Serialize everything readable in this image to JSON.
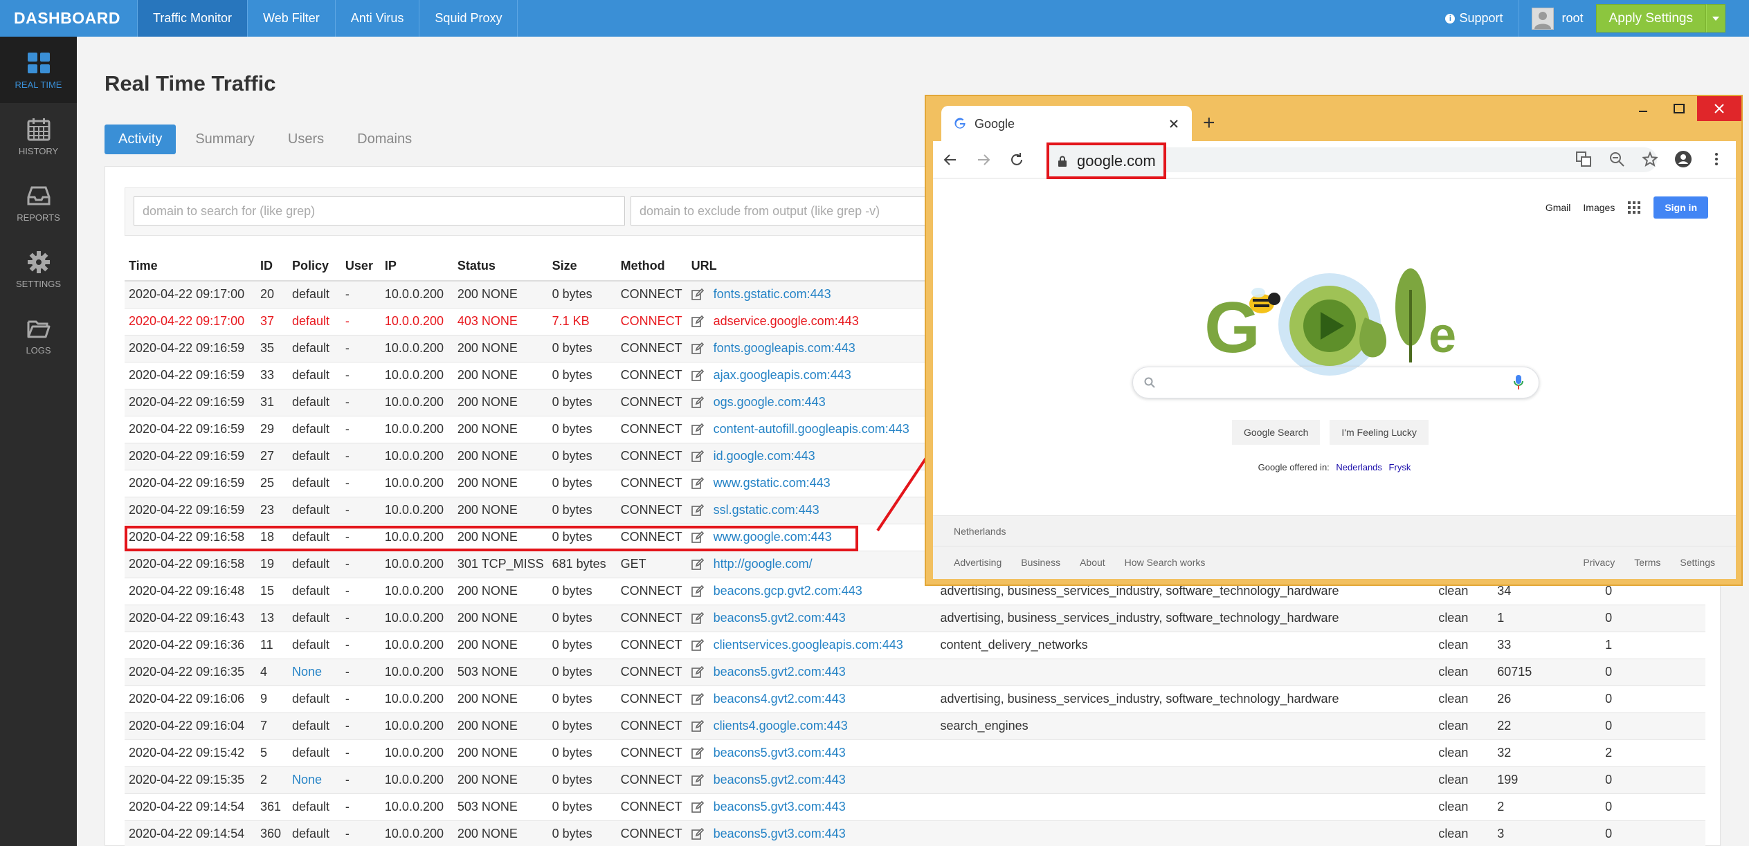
{
  "brand": "DASHBOARD",
  "top_nav": [
    "Traffic Monitor",
    "Web Filter",
    "Anti Virus",
    "Squid Proxy"
  ],
  "support_label": "Support",
  "user_name": "root",
  "apply_label": "Apply Settings",
  "sidebar": [
    {
      "label": "REAL TIME",
      "icon": "grid-icon"
    },
    {
      "label": "HISTORY",
      "icon": "calendar-icon"
    },
    {
      "label": "REPORTS",
      "icon": "inbox-icon"
    },
    {
      "label": "SETTINGS",
      "icon": "gear-icon"
    },
    {
      "label": "LOGS",
      "icon": "folder-icon"
    }
  ],
  "page_title": "Real Time Traffic",
  "tabs": [
    "Activity",
    "Summary",
    "Users",
    "Domains"
  ],
  "filter": {
    "include_placeholder": "domain to search for (like grep)",
    "exclude_placeholder": "domain to exclude from output (like grep -v)"
  },
  "table": {
    "columns": [
      "Time",
      "ID",
      "Policy",
      "User",
      "IP",
      "Status",
      "Size",
      "Method",
      "URL"
    ],
    "rows": [
      {
        "time": "2020-04-22 09:17:00",
        "id": "20",
        "policy": "default",
        "user": "-",
        "ip": "10.0.0.200",
        "status": "200 NONE",
        "size": "0 bytes",
        "method": "CONNECT",
        "url": "fonts.gstatic.com:443",
        "category": "",
        "result": "",
        "n1": "",
        "n2": ""
      },
      {
        "time": "2020-04-22 09:17:00",
        "id": "37",
        "policy": "default",
        "user": "-",
        "ip": "10.0.0.200",
        "status": "403 NONE",
        "size": "7.1 KB",
        "method": "CONNECT",
        "url": "adservice.google.com:443",
        "category": "",
        "result": "",
        "n1": "",
        "n2": "",
        "blocked": true
      },
      {
        "time": "2020-04-22 09:16:59",
        "id": "35",
        "policy": "default",
        "user": "-",
        "ip": "10.0.0.200",
        "status": "200 NONE",
        "size": "0 bytes",
        "method": "CONNECT",
        "url": "fonts.googleapis.com:443",
        "category": "",
        "result": "",
        "n1": "",
        "n2": ""
      },
      {
        "time": "2020-04-22 09:16:59",
        "id": "33",
        "policy": "default",
        "user": "-",
        "ip": "10.0.0.200",
        "status": "200 NONE",
        "size": "0 bytes",
        "method": "CONNECT",
        "url": "ajax.googleapis.com:443",
        "category": "",
        "result": "",
        "n1": "",
        "n2": ""
      },
      {
        "time": "2020-04-22 09:16:59",
        "id": "31",
        "policy": "default",
        "user": "-",
        "ip": "10.0.0.200",
        "status": "200 NONE",
        "size": "0 bytes",
        "method": "CONNECT",
        "url": "ogs.google.com:443",
        "category": "",
        "result": "",
        "n1": "",
        "n2": ""
      },
      {
        "time": "2020-04-22 09:16:59",
        "id": "29",
        "policy": "default",
        "user": "-",
        "ip": "10.0.0.200",
        "status": "200 NONE",
        "size": "0 bytes",
        "method": "CONNECT",
        "url": "content-autofill.googleapis.com:443",
        "category": "",
        "result": "",
        "n1": "",
        "n2": ""
      },
      {
        "time": "2020-04-22 09:16:59",
        "id": "27",
        "policy": "default",
        "user": "-",
        "ip": "10.0.0.200",
        "status": "200 NONE",
        "size": "0 bytes",
        "method": "CONNECT",
        "url": "id.google.com:443",
        "category": "",
        "result": "",
        "n1": "",
        "n2": ""
      },
      {
        "time": "2020-04-22 09:16:59",
        "id": "25",
        "policy": "default",
        "user": "-",
        "ip": "10.0.0.200",
        "status": "200 NONE",
        "size": "0 bytes",
        "method": "CONNECT",
        "url": "www.gstatic.com:443",
        "category": "",
        "result": "",
        "n1": "",
        "n2": ""
      },
      {
        "time": "2020-04-22 09:16:59",
        "id": "23",
        "policy": "default",
        "user": "-",
        "ip": "10.0.0.200",
        "status": "200 NONE",
        "size": "0 bytes",
        "method": "CONNECT",
        "url": "ssl.gstatic.com:443",
        "category": "",
        "result": "",
        "n1": "",
        "n2": ""
      },
      {
        "time": "2020-04-22 09:16:58",
        "id": "18",
        "policy": "default",
        "user": "-",
        "ip": "10.0.0.200",
        "status": "200 NONE",
        "size": "0 bytes",
        "method": "CONNECT",
        "url": "www.google.com:443",
        "category": "",
        "result": "",
        "n1": "",
        "n2": ""
      },
      {
        "time": "2020-04-22 09:16:58",
        "id": "19",
        "policy": "default",
        "user": "-",
        "ip": "10.0.0.200",
        "status": "301 TCP_MISS",
        "size": "681 bytes",
        "method": "GET",
        "url": "http://google.com/",
        "category": "",
        "result": "",
        "n1": "",
        "n2": ""
      },
      {
        "time": "2020-04-22 09:16:48",
        "id": "15",
        "policy": "default",
        "user": "-",
        "ip": "10.0.0.200",
        "status": "200 NONE",
        "size": "0 bytes",
        "method": "CONNECT",
        "url": "beacons.gcp.gvt2.com:443",
        "category": "advertising, business_services_industry, software_technology_hardware",
        "result": "clean",
        "n1": "34",
        "n2": "0"
      },
      {
        "time": "2020-04-22 09:16:43",
        "id": "13",
        "policy": "default",
        "user": "-",
        "ip": "10.0.0.200",
        "status": "200 NONE",
        "size": "0 bytes",
        "method": "CONNECT",
        "url": "beacons5.gvt2.com:443",
        "category": "advertising, business_services_industry, software_technology_hardware",
        "result": "clean",
        "n1": "1",
        "n2": "0"
      },
      {
        "time": "2020-04-22 09:16:36",
        "id": "11",
        "policy": "default",
        "user": "-",
        "ip": "10.0.0.200",
        "status": "200 NONE",
        "size": "0 bytes",
        "method": "CONNECT",
        "url": "clientservices.googleapis.com:443",
        "category": "content_delivery_networks",
        "result": "clean",
        "n1": "33",
        "n2": "1"
      },
      {
        "time": "2020-04-22 09:16:35",
        "id": "4",
        "policy": "None",
        "user": "-",
        "ip": "10.0.0.200",
        "status": "503 NONE",
        "size": "0 bytes",
        "method": "CONNECT",
        "url": "beacons5.gvt2.com:443",
        "category": "",
        "result": "clean",
        "n1": "60715",
        "n2": "0",
        "policy_link": true
      },
      {
        "time": "2020-04-22 09:16:06",
        "id": "9",
        "policy": "default",
        "user": "-",
        "ip": "10.0.0.200",
        "status": "200 NONE",
        "size": "0 bytes",
        "method": "CONNECT",
        "url": "beacons4.gvt2.com:443",
        "category": "advertising, business_services_industry, software_technology_hardware",
        "result": "clean",
        "n1": "26",
        "n2": "0"
      },
      {
        "time": "2020-04-22 09:16:04",
        "id": "7",
        "policy": "default",
        "user": "-",
        "ip": "10.0.0.200",
        "status": "200 NONE",
        "size": "0 bytes",
        "method": "CONNECT",
        "url": "clients4.google.com:443",
        "category": "search_engines",
        "result": "clean",
        "n1": "22",
        "n2": "0"
      },
      {
        "time": "2020-04-22 09:15:42",
        "id": "5",
        "policy": "default",
        "user": "-",
        "ip": "10.0.0.200",
        "status": "200 NONE",
        "size": "0 bytes",
        "method": "CONNECT",
        "url": "beacons5.gvt3.com:443",
        "category": "",
        "result": "clean",
        "n1": "32",
        "n2": "2"
      },
      {
        "time": "2020-04-22 09:15:35",
        "id": "2",
        "policy": "None",
        "user": "-",
        "ip": "10.0.0.200",
        "status": "200 NONE",
        "size": "0 bytes",
        "method": "CONNECT",
        "url": "beacons5.gvt2.com:443",
        "category": "",
        "result": "clean",
        "n1": "199",
        "n2": "0",
        "policy_link": true
      },
      {
        "time": "2020-04-22 09:14:54",
        "id": "361",
        "policy": "default",
        "user": "-",
        "ip": "10.0.0.200",
        "status": "503 NONE",
        "size": "0 bytes",
        "method": "CONNECT",
        "url": "beacons5.gvt3.com:443",
        "category": "",
        "result": "clean",
        "n1": "2",
        "n2": "0"
      },
      {
        "time": "2020-04-22 09:14:54",
        "id": "360",
        "policy": "default",
        "user": "-",
        "ip": "10.0.0.200",
        "status": "200 NONE",
        "size": "0 bytes",
        "method": "CONNECT",
        "url": "beacons5.gvt3.com:443",
        "category": "",
        "result": "clean",
        "n1": "3",
        "n2": "0"
      }
    ]
  },
  "browser": {
    "tab_title": "Google",
    "address": "google.com",
    "top_links": [
      "Gmail",
      "Images"
    ],
    "signin": "Sign in",
    "buttons": [
      "Google Search",
      "I'm Feeling Lucky"
    ],
    "offered_text": "Google offered in:",
    "languages": [
      "Nederlands",
      "Frysk"
    ],
    "country": "Netherlands",
    "footer_left": [
      "Advertising",
      "Business",
      "About",
      "How Search works"
    ],
    "footer_right": [
      "Privacy",
      "Terms",
      "Settings"
    ]
  },
  "colors": {
    "topbar": "#3a8fd6",
    "accent": "#3a8fd6",
    "apply": "#8cc63e",
    "blocked": "#e8191f",
    "highlight": "#e3151b",
    "window_frame": "#f2c060"
  }
}
